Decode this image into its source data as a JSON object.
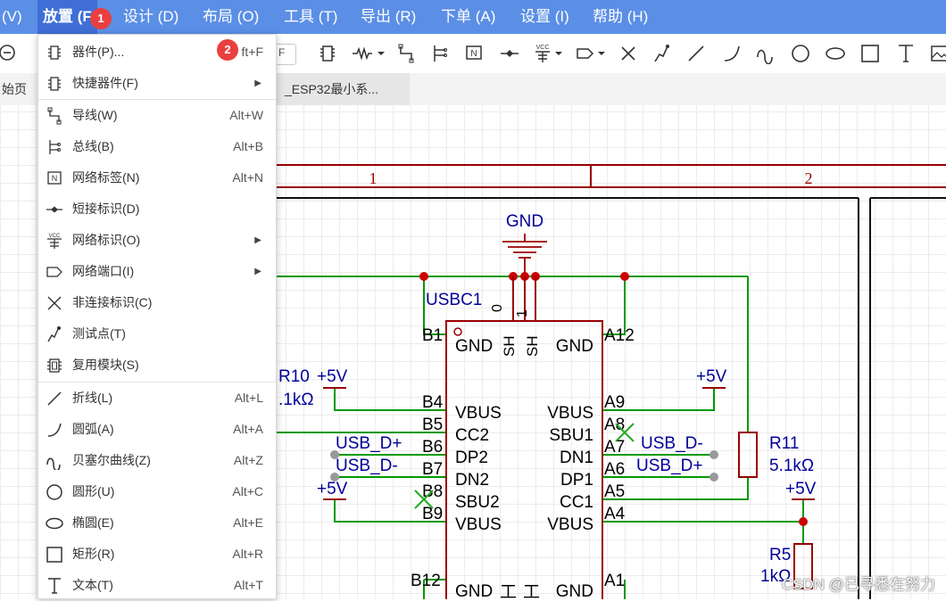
{
  "menubar": {
    "items": [
      "(V)",
      "放置 (P)",
      "设计 (D)",
      "布局 (O)",
      "工具 (T)",
      "导出 (R)",
      "下单 (A)",
      "设置 (I)",
      "帮助 (H)"
    ],
    "place_visible": "放置 (F"
  },
  "toolbar": {
    "combo_text": "F",
    "icons": [
      "zoom-out-icon",
      "component-icon",
      "resistor-icon",
      "wire-icon",
      "bus-icon",
      "net-label-icon",
      "short-flag-icon",
      "vcc-icon",
      "net-port-icon",
      "no-connect-icon",
      "probe-icon",
      "line-icon",
      "arc-icon",
      "bezier-icon",
      "circle-icon",
      "ellipse-icon",
      "rectangle-icon",
      "text-icon",
      "image-icon"
    ]
  },
  "tabs": {
    "start": "始页",
    "esp": "_ESP32最小系..."
  },
  "badges": [
    "1",
    "2"
  ],
  "menu": {
    "items": [
      {
        "label": "器件(P)...",
        "shortcut": "ft+F",
        "icon": "component-icon"
      },
      {
        "label": "快捷器件(F)",
        "submenu": true,
        "icon": "quick-component-icon"
      },
      {
        "label": "导线(W)",
        "shortcut": "Alt+W",
        "icon": "wire-icon"
      },
      {
        "label": "总线(B)",
        "shortcut": "Alt+B",
        "icon": "bus-icon"
      },
      {
        "label": "网络标签(N)",
        "shortcut": "Alt+N",
        "icon": "net-label-icon"
      },
      {
        "label": "短接标识(D)",
        "icon": "short-flag-icon"
      },
      {
        "label": "网络标识(O)",
        "submenu": true,
        "icon": "vcc-icon"
      },
      {
        "label": "网络端口(I)",
        "submenu": true,
        "icon": "net-port-icon"
      },
      {
        "label": "非连接标识(C)",
        "icon": "no-connect-icon"
      },
      {
        "label": "测试点(T)",
        "icon": "probe-icon"
      },
      {
        "label": "复用模块(S)",
        "icon": "reuse-module-icon"
      },
      {
        "label": "折线(L)",
        "shortcut": "Alt+L",
        "icon": "line-icon"
      },
      {
        "label": "圆弧(A)",
        "shortcut": "Alt+A",
        "icon": "arc-icon"
      },
      {
        "label": "贝塞尔曲线(Z)",
        "shortcut": "Alt+Z",
        "icon": "bezier-icon"
      },
      {
        "label": "圆形(U)",
        "shortcut": "Alt+C",
        "icon": "circle-icon"
      },
      {
        "label": "椭圆(E)",
        "shortcut": "Alt+E",
        "icon": "ellipse-icon"
      },
      {
        "label": "矩形(R)",
        "shortcut": "Alt+R",
        "icon": "rectangle-icon"
      },
      {
        "label": "文本(T)",
        "shortcut": "Alt+T",
        "icon": "text-icon"
      }
    ]
  },
  "schematic": {
    "frame_cols": [
      "1",
      "2"
    ],
    "gnd_label": "GND",
    "designator": "USBC1",
    "shield_pins": [
      "0",
      "1"
    ],
    "left_pins": [
      {
        "num": "B1",
        "name": "GND"
      },
      {
        "num": "B4",
        "name": "VBUS"
      },
      {
        "num": "B5",
        "name": "CC2"
      },
      {
        "num": "B6",
        "name": "DP2"
      },
      {
        "num": "B7",
        "name": "DN2"
      },
      {
        "num": "B8",
        "name": "SBU2"
      },
      {
        "num": "B9",
        "name": "VBUS"
      },
      {
        "num": "B12",
        "name": "GND"
      }
    ],
    "right_pins": [
      {
        "num": "A12",
        "name": "GND"
      },
      {
        "num": "A9",
        "name": "VBUS"
      },
      {
        "num": "A8",
        "name": "SBU1"
      },
      {
        "num": "A7",
        "name": "DN1"
      },
      {
        "num": "A6",
        "name": "DP1"
      },
      {
        "num": "A5",
        "name": "CC1"
      },
      {
        "num": "A4",
        "name": "VBUS"
      },
      {
        "num": "A1",
        "name": "GND"
      }
    ],
    "shield_names": [
      "SH",
      "SH"
    ],
    "bottom_shield_names": [
      "工",
      "工"
    ],
    "r10_designator": "R10",
    "r10_value": ".1kΩ",
    "r11_designator": "R11",
    "r11_value": "5.1kΩ",
    "r5_designator": "R5",
    "r5_value": "1kΩ",
    "vcc_label": "+5V",
    "net_usb_dp": "USB_D+",
    "net_usb_dm": "USB_D-",
    "colors": {
      "wire": "#009900",
      "component": "#990000",
      "net": "#000099",
      "accent": "#5b8fe6"
    }
  },
  "watermark": "CSDN @已寻悉在努力"
}
